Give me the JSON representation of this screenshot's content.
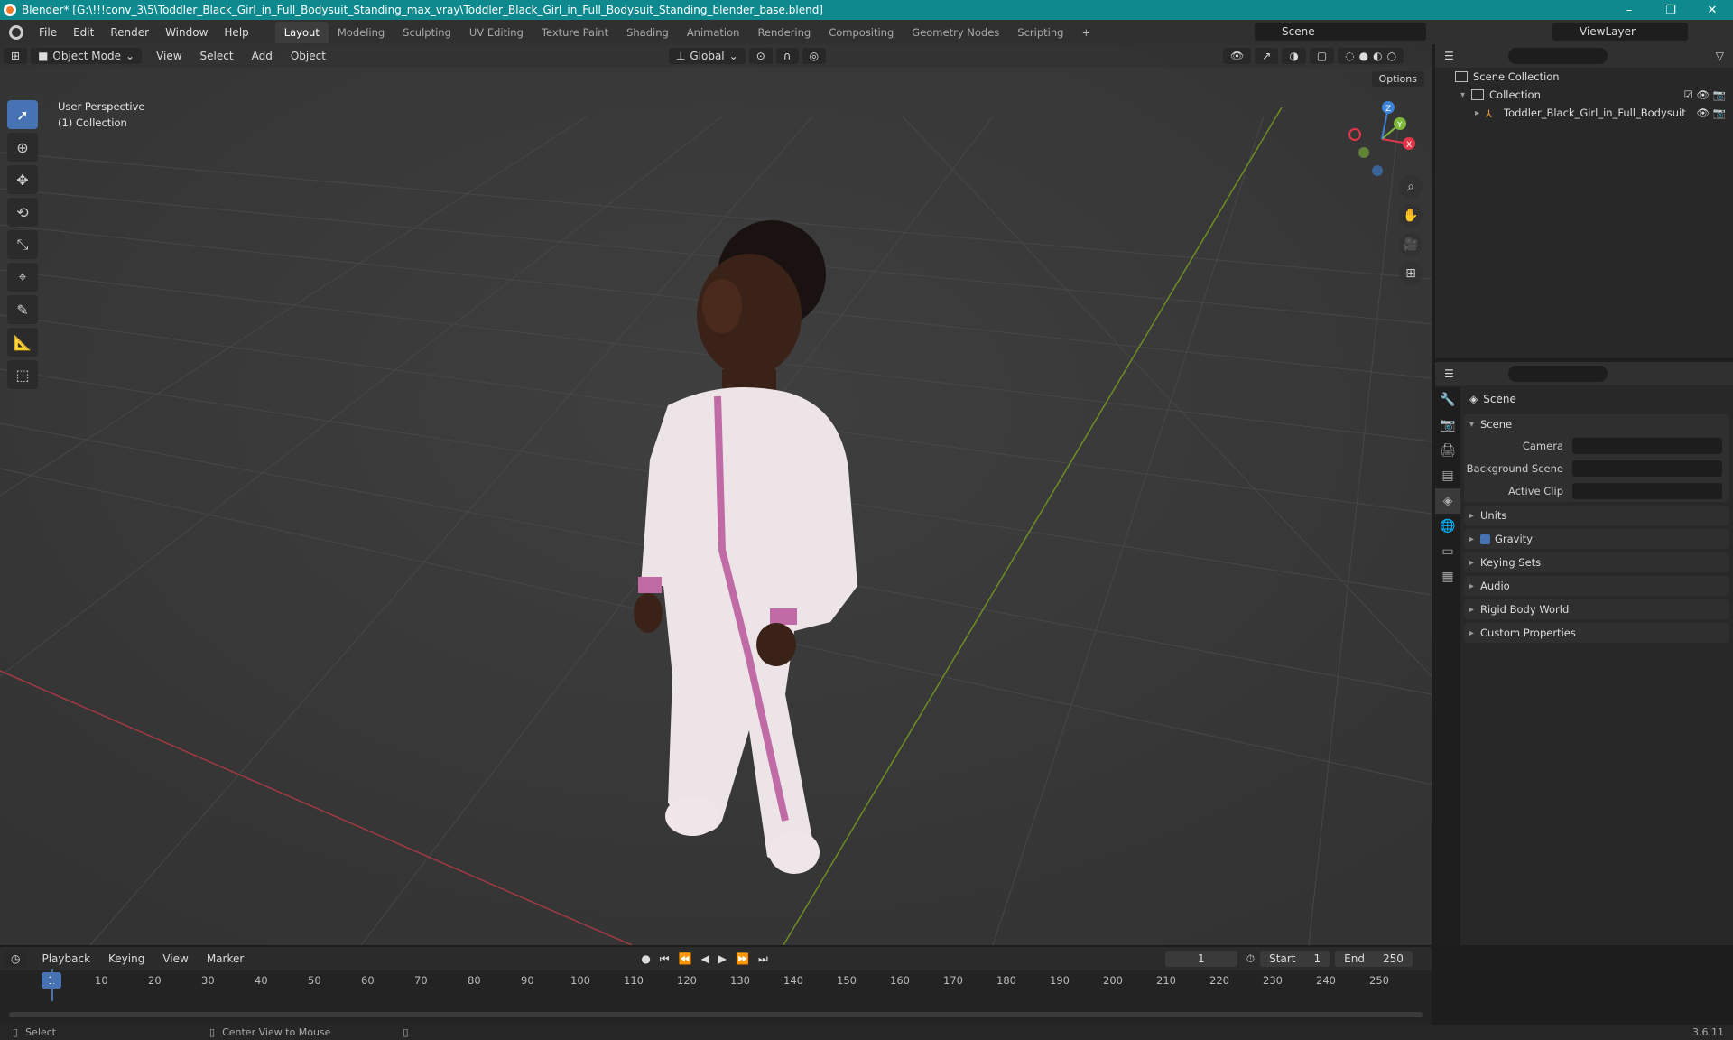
{
  "titlebar": {
    "title": "Blender* [G:\\!!!conv_3\\5\\Toddler_Black_Girl_in_Full_Bodysuit_Standing_max_vray\\Toddler_Black_Girl_in_Full_Bodysuit_Standing_blender_base.blend]",
    "minimize": "–",
    "maximize": "❐",
    "close": "✕"
  },
  "menu": [
    "File",
    "Edit",
    "Render",
    "Window",
    "Help"
  ],
  "workspaces": [
    "Layout",
    "Modeling",
    "Sculpting",
    "UV Editing",
    "Texture Paint",
    "Shading",
    "Animation",
    "Rendering",
    "Compositing",
    "Geometry Nodes",
    "Scripting"
  ],
  "workspace_add": "+",
  "scene_name": "Scene",
  "view_layer": "ViewLayer",
  "viewport": {
    "mode": "Object Mode",
    "menu": [
      "View",
      "Select",
      "Add",
      "Object"
    ],
    "transform": "Global",
    "options": "Options",
    "perspective": "User Perspective",
    "collection": "(1) Collection"
  },
  "gizmo": {
    "x": "X",
    "y": "Y",
    "z": "Z",
    "colors": {
      "x": "#e2374a",
      "y": "#7fb83b",
      "z": "#3e82d9"
    }
  },
  "outliner": {
    "scene_collection": "Scene Collection",
    "collection": "Collection",
    "object": "Toddler_Black_Girl_in_Full_Bodysuit"
  },
  "properties": {
    "header": "Scene",
    "scene_panel": "Scene",
    "fields": [
      {
        "label": "Camera"
      },
      {
        "label": "Background Scene"
      },
      {
        "label": "Active Clip"
      }
    ],
    "panels": [
      "Units",
      "Gravity",
      "Keying Sets",
      "Audio",
      "Rigid Body World",
      "Custom Properties"
    ]
  },
  "timeline": {
    "menu": [
      "Playback",
      "Keying",
      "View",
      "Marker"
    ],
    "current_frame": "1",
    "start_label": "Start",
    "start": "1",
    "end_label": "End",
    "end": "250",
    "ticks": [
      "1",
      "10",
      "20",
      "30",
      "40",
      "50",
      "60",
      "70",
      "80",
      "90",
      "100",
      "110",
      "120",
      "130",
      "140",
      "150",
      "160",
      "170",
      "180",
      "190",
      "200",
      "210",
      "220",
      "230",
      "240",
      "250"
    ]
  },
  "status": {
    "select": "Select",
    "center": "Center View to Mouse",
    "version": "3.6.11"
  }
}
